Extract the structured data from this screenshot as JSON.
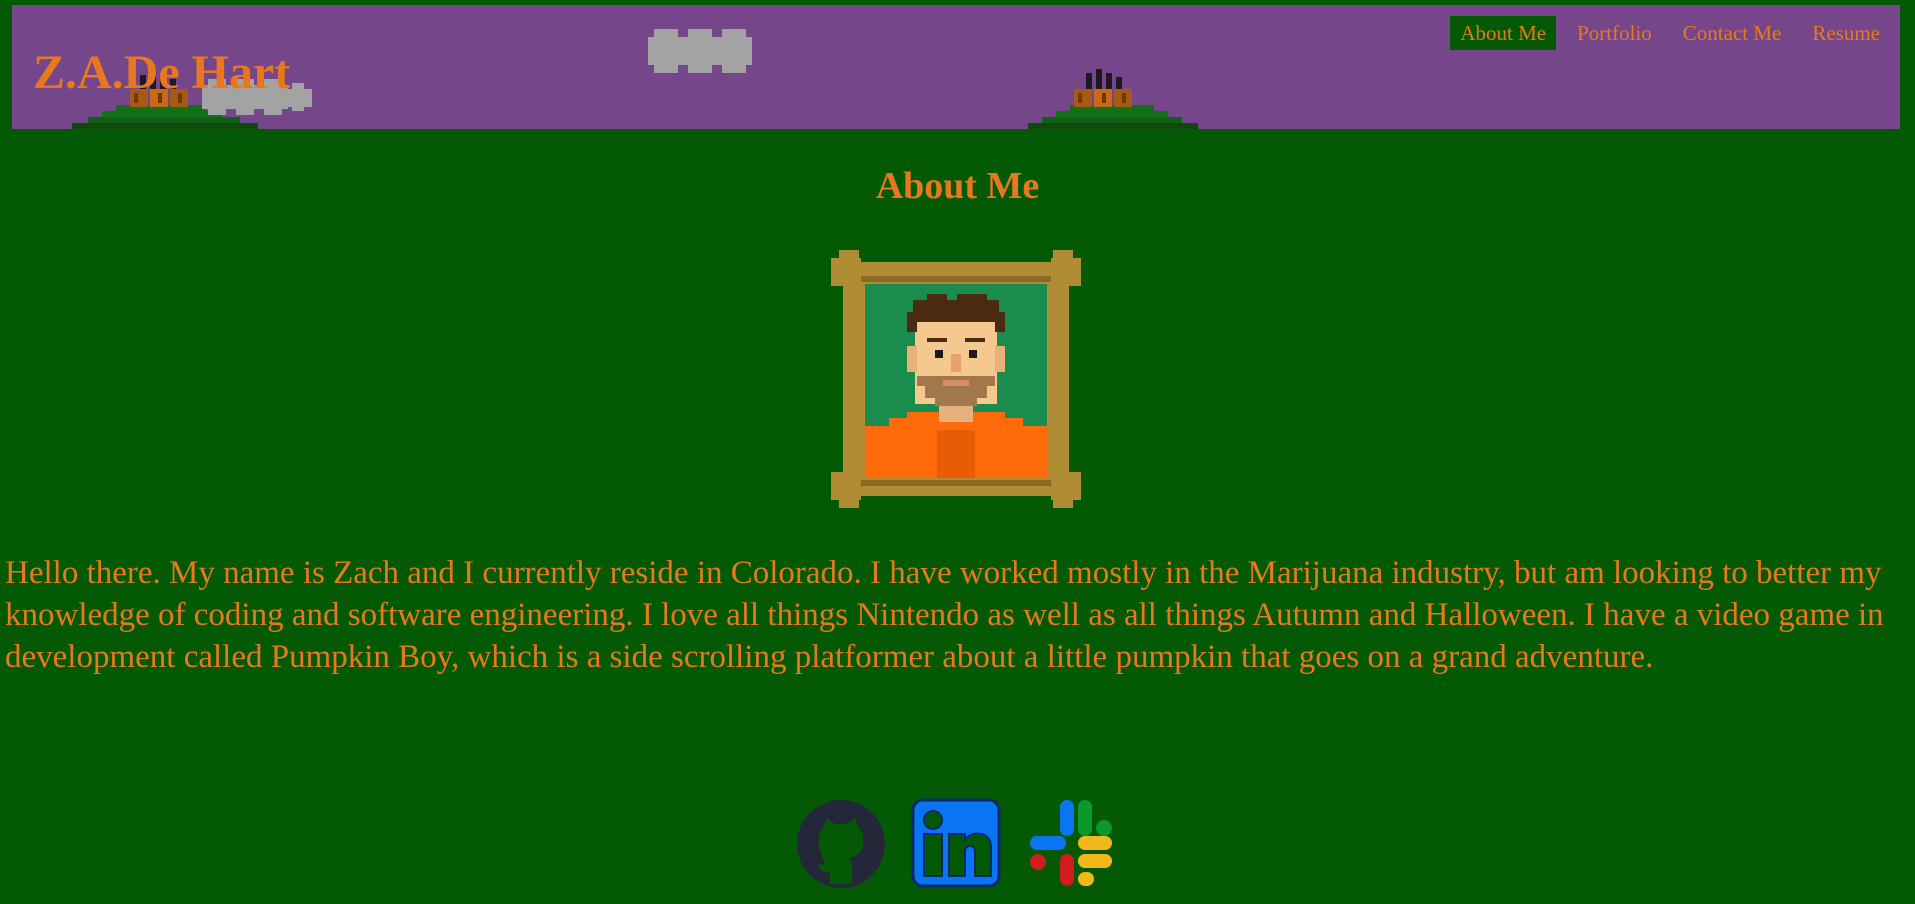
{
  "site": {
    "brand": "Z.A.De Hart"
  },
  "nav": {
    "items": [
      {
        "label": "About Me",
        "active": true
      },
      {
        "label": "Portfolio",
        "active": false
      },
      {
        "label": "Contact Me",
        "active": false
      },
      {
        "label": "Resume",
        "active": false
      }
    ]
  },
  "main": {
    "heading": "About Me",
    "bio": "Hello there. My name is Zach and I currently reside in Colorado. I have worked mostly in the Marijuana industry, but am looking to better my knowledge of coding and software engineering. I love all things Nintendo as well as all things Autumn and Halloween. I have a video game in development called Pumpkin Boy, which is a side scrolling platformer about a little pumpkin that goes on a grand adventure."
  },
  "socials": [
    {
      "name": "github-icon"
    },
    {
      "name": "linkedin-icon"
    },
    {
      "name": "slack-icon"
    }
  ],
  "colors": {
    "background": "#045a04",
    "header": "#76468a",
    "text": "#e8781e",
    "frame": "#b08c34",
    "portrait_bg": "#1a8c4e",
    "shirt": "#ff6a0a"
  }
}
